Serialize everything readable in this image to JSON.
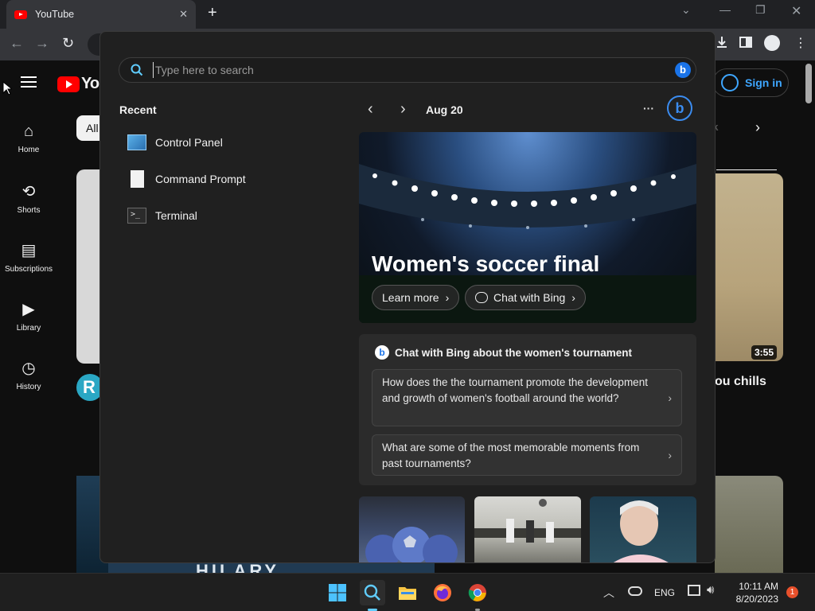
{
  "browser": {
    "tab_title": "YouTube",
    "tab_close": "✕",
    "new_tab": "+"
  },
  "youtube": {
    "logo_text": "You",
    "sign_in": "Sign in",
    "chip_all": "All",
    "chip_partial": "ck",
    "sidebar": [
      {
        "label": "Home",
        "icon": "home-icon"
      },
      {
        "label": "Shorts",
        "icon": "shorts-icon"
      },
      {
        "label": "Subscriptions",
        "icon": "subscriptions-icon"
      },
      {
        "label": "Library",
        "icon": "library-icon"
      },
      {
        "label": "History",
        "icon": "history-icon"
      }
    ],
    "video_duration": "3:55",
    "video_title_partial": "ou chills",
    "avatar_letter": "R",
    "bottom_thumb_text": "HILARY"
  },
  "search": {
    "placeholder": "Type here to search",
    "recent_title": "Recent",
    "recent_items": [
      "Control Panel",
      "Command Prompt",
      "Terminal"
    ],
    "date": "Aug 20",
    "more": "···",
    "hero": {
      "title": "Women's soccer final",
      "learn_more": "Learn more",
      "chat_with_bing": "Chat with Bing"
    },
    "bing_card": {
      "title": "Chat with Bing about the women's tournament",
      "questions": [
        "How does the the tournament promote the development and growth of women's football around the world?",
        "What are some of the most memorable moments from past tournaments?"
      ]
    }
  },
  "taskbar": {
    "language": "ENG",
    "time": "10:11 AM",
    "date": "8/20/2023",
    "notification_count": "1"
  },
  "colors": {
    "yt_red": "#ff0000",
    "link_blue": "#3ea6ff",
    "bing_blue": "#1a73e8",
    "taskbar_bg": "#1f1f1f",
    "panel_bg": "#202020"
  }
}
